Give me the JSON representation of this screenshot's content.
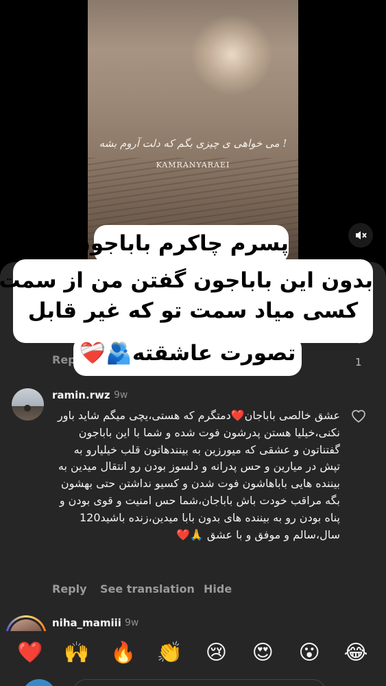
{
  "video": {
    "caption_fa": "می خواهی ی چیزی بگم که دلت آروم بشه !",
    "caption_name": "KAMRANYARAEI"
  },
  "overlay_text": {
    "line1": "پسرم چاکرم باباجون",
    "line2": "بدون این باباجون گفتن من از سمت",
    "line3": "کسی میاد سمت تو که غیر قابل",
    "line4": "تصورت عاشقته🫂❤️‍🩹"
  },
  "previous_comment": {
    "reply_label": "Reply",
    "like_count": "1",
    "emoji": "😭"
  },
  "comment": {
    "username": "ramin.rwz",
    "timestamp": "9w",
    "text": "عشق خالصی باباجان❤️دمتگرم که هستی،یچی میگم شاید باور نکنی،خیلیا هستن پدرشون فوت شده و شما با این باباجون گفتناتون و عشقی که میورزین به بینندهاتون قلب خیلیارو به تپش در میارین و حس پدرانه و دلسوز بودن رو انتقال میدین به بیننده هایی باباهاشون فوت شدن و کسیو نداشتن حتی بهشون بگه مراقب خودت باش باباجان،شما حس امنیت و قوی بودن و پناه بودن رو به بیننده های بدون بابا میدین،زنده باشید120 سال،سالم و موفق و با عشق 🙏❤️",
    "actions": {
      "reply": "Reply",
      "translate": "See translation",
      "hide": "Hide"
    }
  },
  "next_comment": {
    "username": "niha_mamiii",
    "timestamp": "9w"
  },
  "emoji_bar": [
    "❤️",
    "🙌",
    "🔥",
    "👏",
    "😢",
    "😍",
    "😮",
    "😂"
  ],
  "colors": {
    "like_red": "#ff3040",
    "sheet_bg": "#262626"
  }
}
